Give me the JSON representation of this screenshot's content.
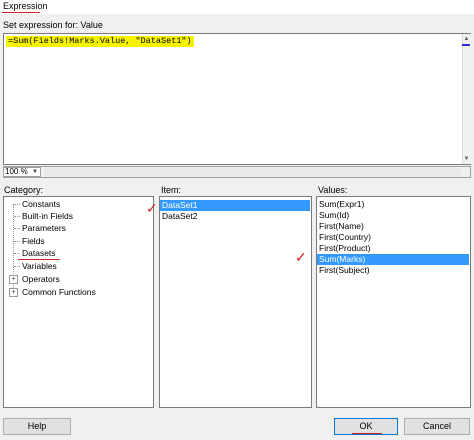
{
  "window": {
    "title": "Expression"
  },
  "editor": {
    "label": "Set expression for: Value",
    "expression": "=Sum(Fields!Marks.Value, \"DataSet1\")",
    "zoom": "100 %"
  },
  "category": {
    "label": "Category:",
    "items": [
      {
        "label": "Constants",
        "expandable": false
      },
      {
        "label": "Built-in Fields",
        "expandable": false
      },
      {
        "label": "Parameters",
        "expandable": false
      },
      {
        "label": "Fields",
        "expandable": false
      },
      {
        "label": "Datasets",
        "expandable": false
      },
      {
        "label": "Variables",
        "expandable": false
      },
      {
        "label": "Operators",
        "expandable": true
      },
      {
        "label": "Common Functions",
        "expandable": true
      }
    ],
    "expander_symbol": "+"
  },
  "item": {
    "label": "Item:",
    "items": [
      "DataSet1",
      "DataSet2"
    ],
    "selected": "DataSet1"
  },
  "values": {
    "label": "Values:",
    "items": [
      "Sum(Expr1)",
      "Sum(Id)",
      "First(Name)",
      "First(Country)",
      "First(Product)",
      "Sum(Marks)",
      "First(Subject)"
    ],
    "selected": "Sum(Marks)"
  },
  "buttons": {
    "help": "Help",
    "ok": "OK",
    "cancel": "Cancel"
  },
  "colors": {
    "selection": "#3399ff",
    "highlight": "#f7f300",
    "annotation": "#d32020"
  }
}
